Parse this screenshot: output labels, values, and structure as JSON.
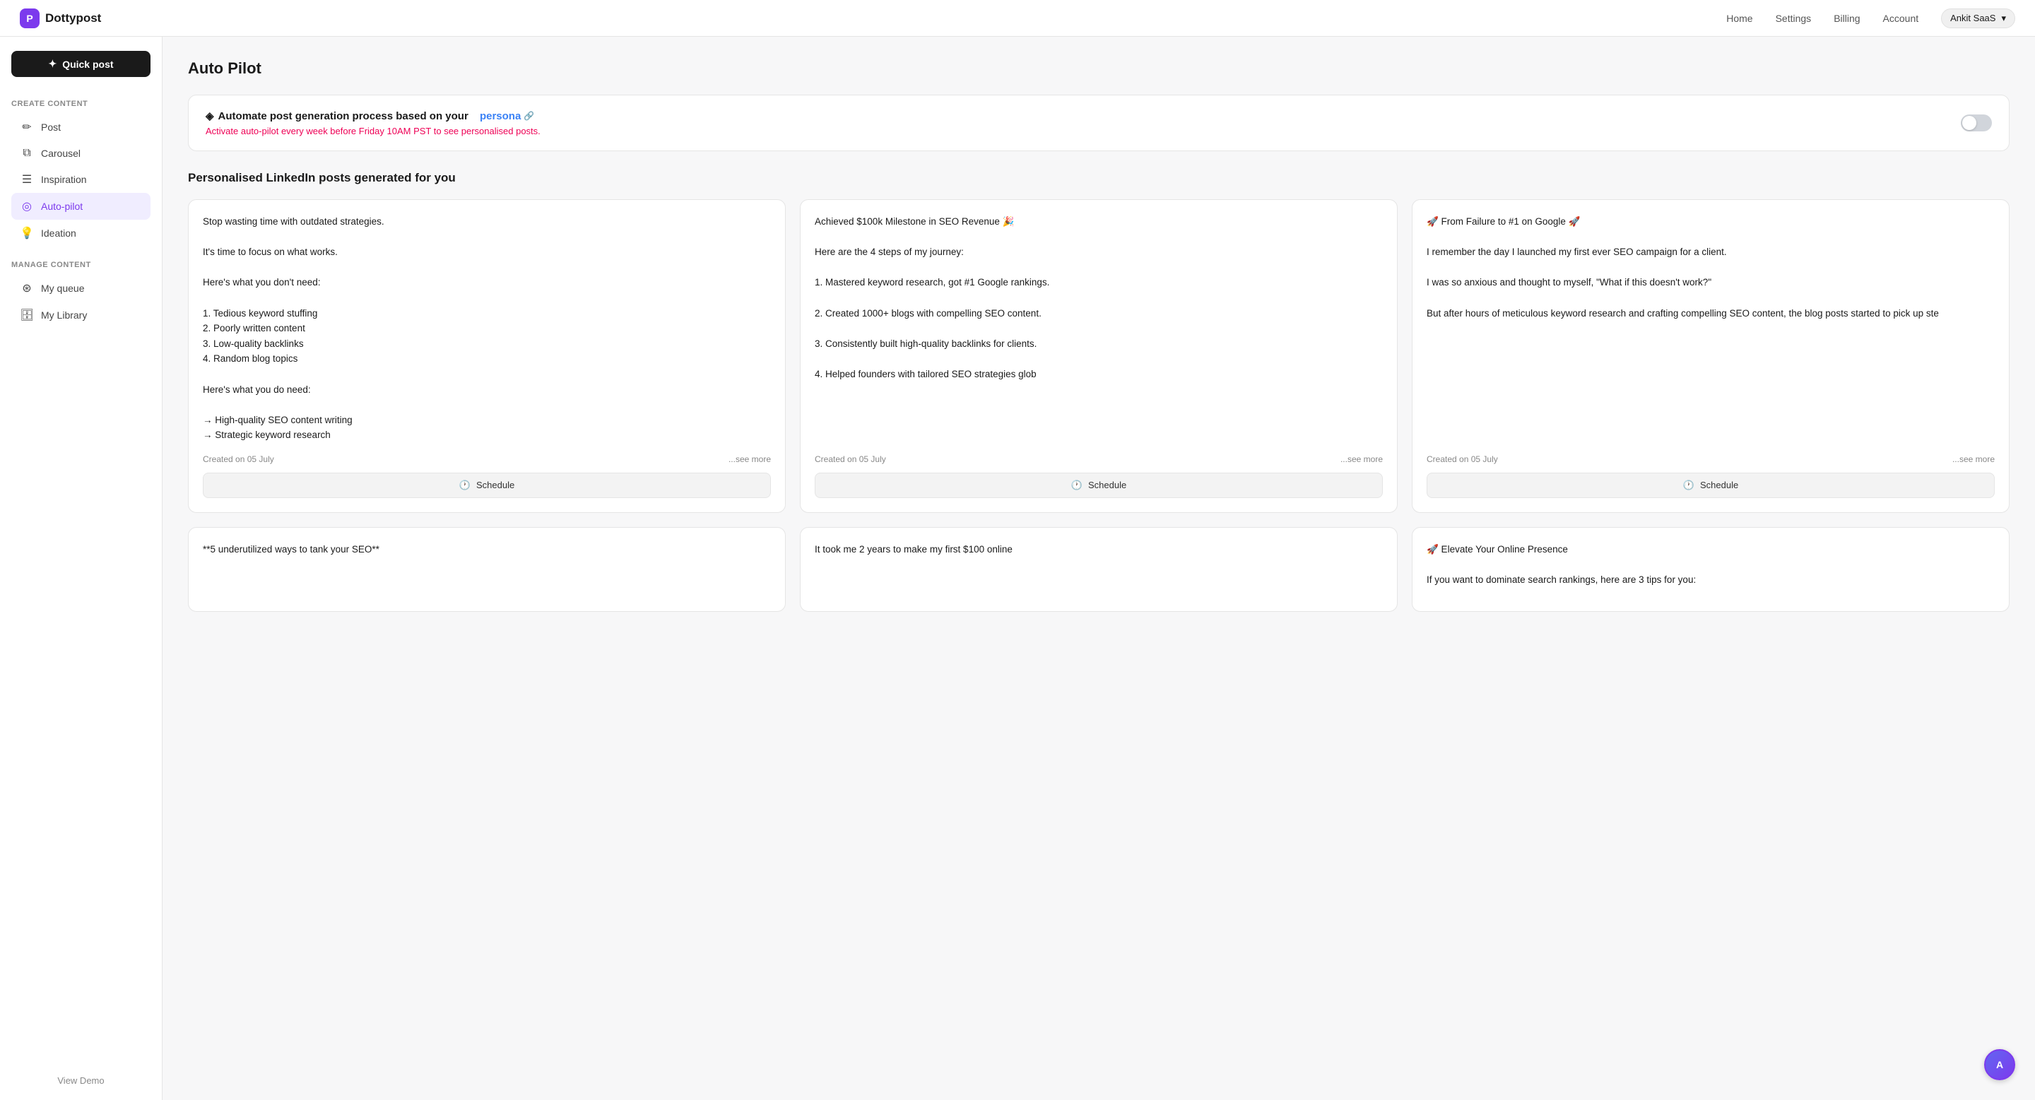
{
  "topbar": {
    "logo_text": "Dottypost",
    "nav": [
      "Home",
      "Settings",
      "Billing",
      "Account"
    ],
    "user_label": "Ankit SaaS"
  },
  "sidebar": {
    "quick_post_label": "Quick post",
    "create_section_label": "Create content",
    "manage_section_label": "Manage content",
    "create_items": [
      {
        "label": "Post",
        "icon": "✏️",
        "id": "post"
      },
      {
        "label": "Carousel",
        "icon": "⊞",
        "id": "carousel"
      },
      {
        "label": "Inspiration",
        "icon": "📋",
        "id": "inspiration"
      },
      {
        "label": "Auto-pilot",
        "icon": "◎",
        "id": "autopilot",
        "active": true
      },
      {
        "label": "Ideation",
        "icon": "💡",
        "id": "ideation"
      }
    ],
    "manage_items": [
      {
        "label": "My queue",
        "icon": "🗂",
        "id": "queue"
      },
      {
        "label": "My Library",
        "icon": "🗄",
        "id": "library"
      }
    ],
    "view_demo_label": "View Demo"
  },
  "page": {
    "title": "Auto Pilot"
  },
  "banner": {
    "text_prefix": "Automate post generation process based on your",
    "persona_text": "persona",
    "edit_icon": "✏",
    "subtitle": "Activate auto-pilot every week before Friday 10AM PST to see personalised posts."
  },
  "section": {
    "heading": "Personalised LinkedIn posts generated for you"
  },
  "cards": [
    {
      "body": "Stop wasting time with outdated strategies.\n\nIt's time to focus on what works.\n\nHere's what you don't need:\n\n1. Tedious keyword stuffing\n2. Poorly written content\n3. Low-quality backlinks\n4. Random blog topics\n\nHere's what you do need:\n\n→ High-quality SEO content writing\n→ Strategic keyword research",
      "date": "Created on 05 July",
      "see_more": "...see more"
    },
    {
      "body": "Achieved $100k Milestone in SEO Revenue 🎉\n\nHere are the 4 steps of my journey:\n\n1. Mastered keyword research, got #1 Google rankings.\n\n2. Created 1000+ blogs with compelling SEO content.\n\n3. Consistently built high-quality backlinks for clients.\n\n4. Helped founders with tailored SEO strategies glob",
      "date": "Created on 05 July",
      "see_more": "...see more"
    },
    {
      "body": "🚀 From Failure to #1 on Google 🚀\n\nI remember the day I launched my first ever SEO campaign for a client.\n\nI was so anxious and thought to myself, \"What if this doesn't work?\"\n\nBut after hours of meticulous keyword research and crafting compelling SEO content, the blog posts started to pick up ste",
      "date": "Created on 05 July",
      "see_more": "...see more"
    },
    {
      "body": "**5 underutilized ways to tank your SEO**",
      "date": "",
      "see_more": ""
    },
    {
      "body": "It took me 2 years to make my first $100 online",
      "date": "",
      "see_more": ""
    },
    {
      "body": "🚀 Elevate Your Online Presence\n\nIf you want to dominate search rankings, here are 3 tips for you:",
      "date": "",
      "see_more": ""
    }
  ],
  "schedule_label": "Schedule",
  "clock_icon": "🕐"
}
